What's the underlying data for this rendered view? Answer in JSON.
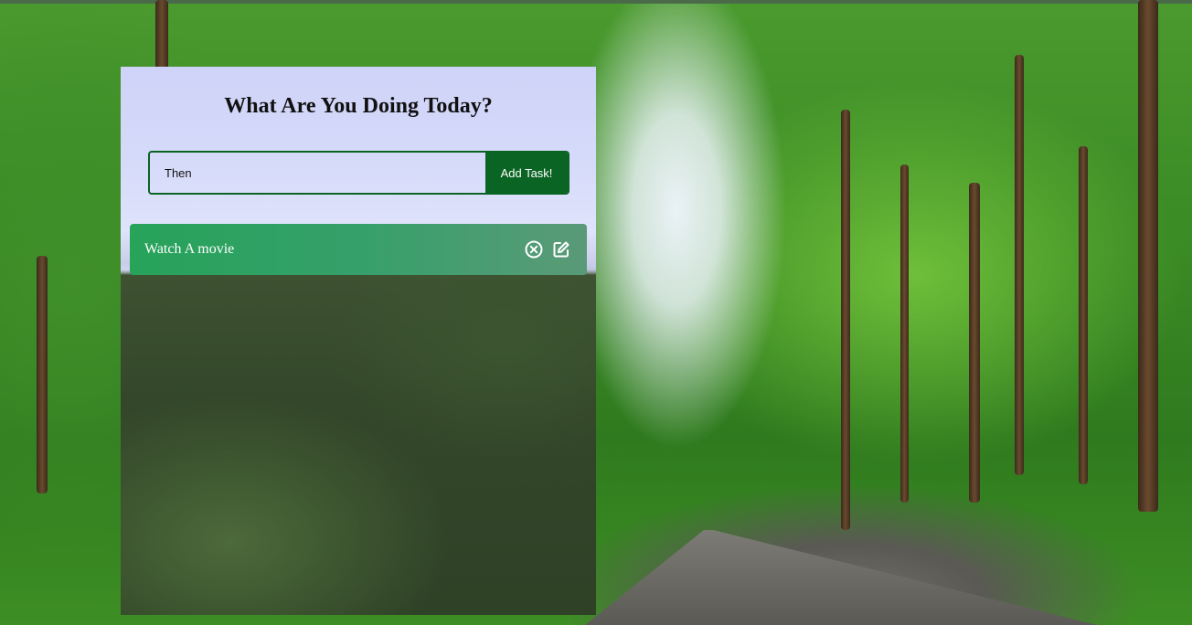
{
  "app": {
    "title": "What Are You Doing Today?"
  },
  "input": {
    "value": "Then",
    "button_label": "Add Task!"
  },
  "tasks": [
    {
      "text": "Watch A movie",
      "icons": [
        "close-circle-icon",
        "edit-icon"
      ]
    }
  ],
  "colors": {
    "accent": "#0a6423",
    "task_bg": "#27a35a",
    "title_text": "#111111"
  }
}
